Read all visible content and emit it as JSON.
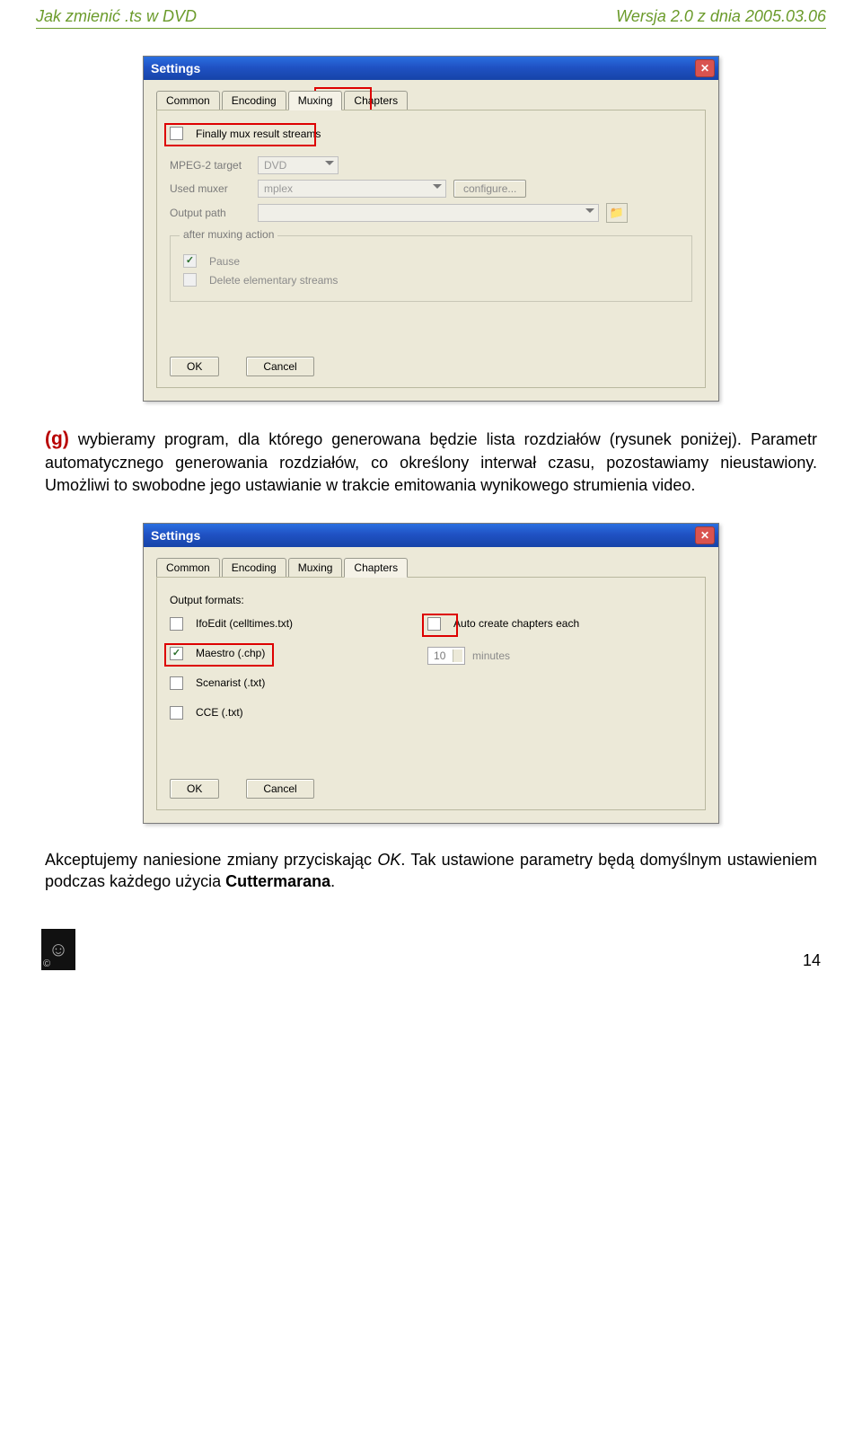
{
  "header": {
    "left": "Jak zmienić .ts w DVD",
    "right": "Wersja 2.0  z dnia 2005.03.06"
  },
  "dialog1": {
    "title": "Settings",
    "tabs": [
      "Common",
      "Encoding",
      "Muxing",
      "Chapters"
    ],
    "active_tab_index": 2,
    "g_mark": "g",
    "finally_mux": {
      "label": "Finally mux result streams",
      "checked": false
    },
    "mpeg2": {
      "label": "MPEG-2 target",
      "value": "DVD"
    },
    "muxer": {
      "label": "Used muxer",
      "value": "mplex",
      "configure": "configure..."
    },
    "output": {
      "label": "Output path"
    },
    "after": {
      "legend": "after muxing action",
      "pause": {
        "label": "Pause",
        "checked": true
      },
      "delete": {
        "label": "Delete elementary streams",
        "checked": false
      }
    },
    "ok": "OK",
    "cancel": "Cancel"
  },
  "para1": {
    "prefix": "(g)",
    "text": " wybieramy program, dla którego generowana będzie lista rozdziałów (rysunek poniżej). Parametr automatycznego generowania rozdziałów, co określony interwał czasu, pozostawiamy nieustawiony. Umożliwi to swobodne jego ustawianie w trakcie emitowania wynikowego strumienia video."
  },
  "dialog2": {
    "title": "Settings",
    "tabs": [
      "Common",
      "Encoding",
      "Muxing",
      "Chapters"
    ],
    "active_tab_index": 3,
    "output_formats_label": "Output formats:",
    "formats": {
      "ifo": {
        "label": "IfoEdit (celltimes.txt)",
        "checked": false
      },
      "maestro": {
        "label": "Maestro (.chp)",
        "checked": true
      },
      "scenarist": {
        "label": "Scenarist (.txt)",
        "checked": false
      },
      "cce": {
        "label": "CCE (.txt)",
        "checked": false
      }
    },
    "auto": {
      "label": "Auto create chapters each",
      "checked": false,
      "value": "10",
      "unit": "minutes"
    },
    "ok": "OK",
    "cancel": "Cancel"
  },
  "para2_a": "Akceptujemy naniesione zmiany przyciskając ",
  "para2_ok": "OK",
  "para2_b": ". Tak ustawione parametry będą domyślnym ustawieniem podczas każdego użycia ",
  "para2_app": "Cuttermarana",
  "para2_end": ".",
  "page_number": "14"
}
